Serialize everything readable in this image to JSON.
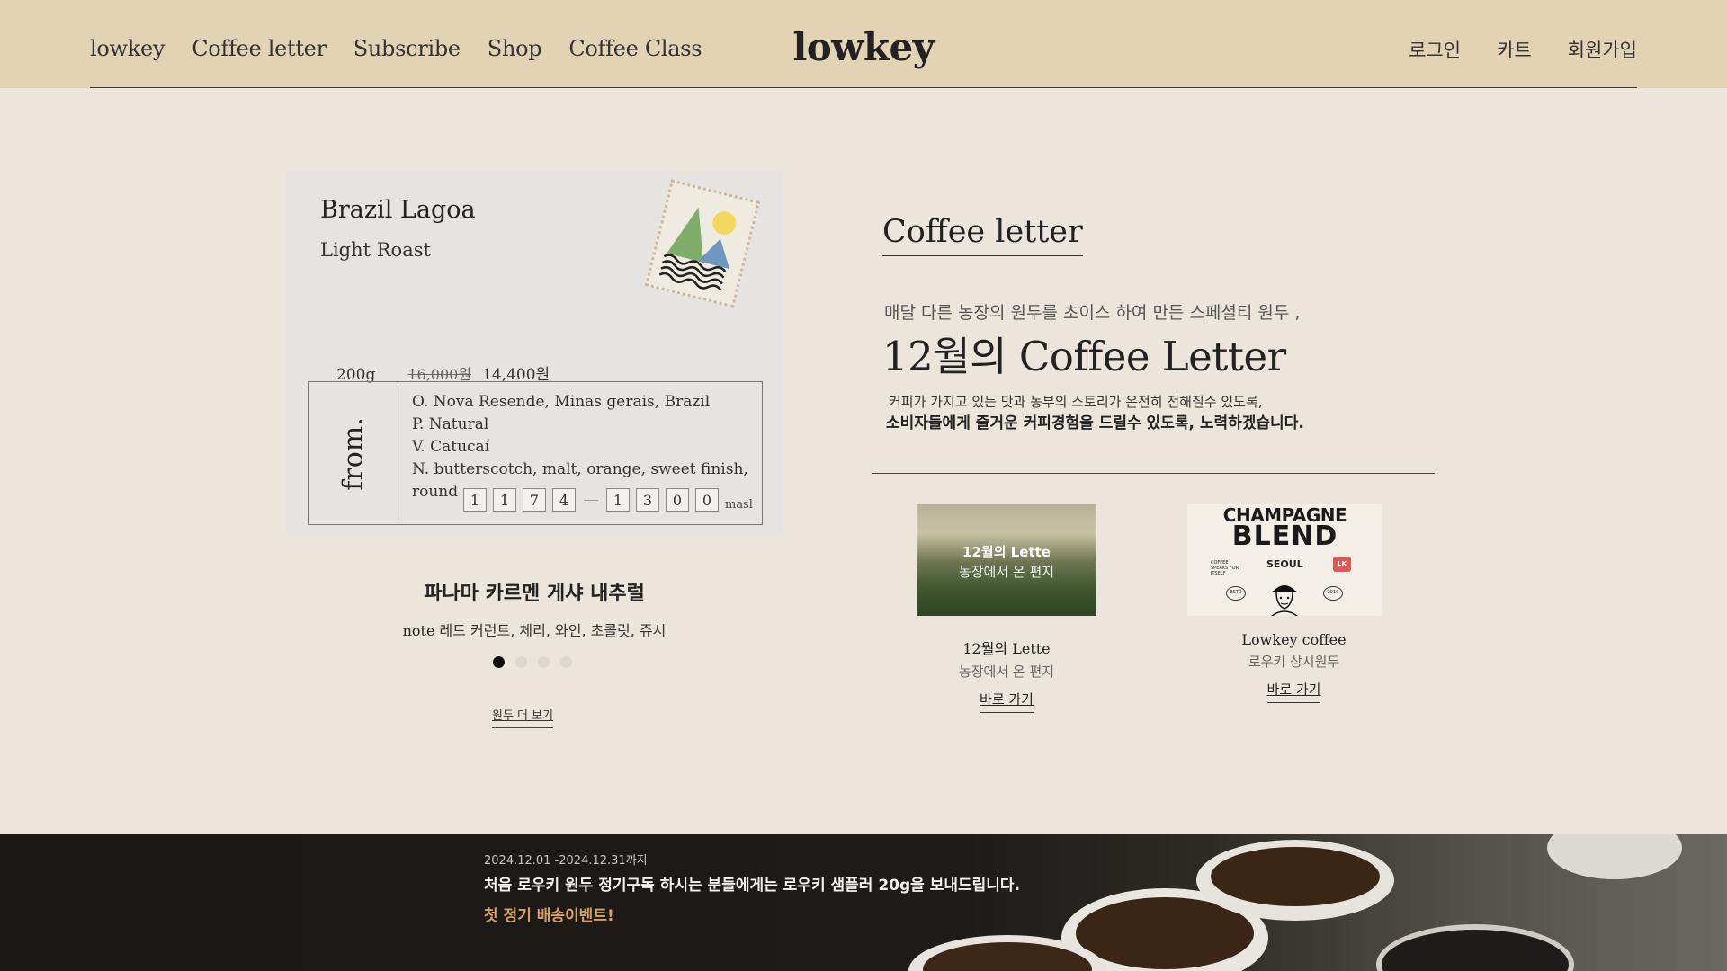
{
  "nav": {
    "left": [
      "lowkey",
      "Coffee letter",
      "Subscribe",
      "Shop",
      "Coffee Class"
    ],
    "logo": "lowkey",
    "right": [
      "로그인",
      "카트",
      "회원가입"
    ]
  },
  "product_card": {
    "name": "Brazil Lagoa",
    "roast": "Light Roast",
    "weight": "200g",
    "original_price": "16,000원",
    "price": "14,400원",
    "from_label": "from.",
    "origin": "O. Nova Resende, Minas gerais, Brazil",
    "process": "P. Natural",
    "variety": "V. Catucaí",
    "notes": "N. butterscotch, malt, orange, sweet finish, round",
    "altitude_digits_low": [
      "1",
      "1",
      "7",
      "4"
    ],
    "altitude_digits_high": [
      "1",
      "3",
      "0",
      "0"
    ],
    "altitude_unit": "masl"
  },
  "featured": {
    "title": "파나마 카르멘 게샤 내추럴",
    "note_label": "note",
    "note_text": "레드 커런트, 체리, 와인, 초콜릿, 쥬시",
    "slide_count": 4,
    "active_slide": 1,
    "more_link": "원두 더 보기"
  },
  "letter": {
    "heading": "Coffee letter",
    "intro": "매달 다른 농장의 원두를 초이스 하여 만든 스페셜티 원두 ,",
    "big_title": "12월의 Coffee Letter",
    "desc_line1": "커피가 가지고 있는 맛과 농부의 스토리가 온전히 전해질수 있도록,",
    "desc_line2": "소비자들에게 즐거운 커피경험을 드릴수 있도록, 노력하겠습니다.",
    "items": [
      {
        "image_title": "12월의 Lette",
        "image_subtitle": "농장에서 온 편지",
        "title": "12월의 Lette",
        "subtitle": "농장에서 온 편지",
        "link": "바로 가기"
      },
      {
        "image_line1": "CHAMPAGNE",
        "image_line2": "BLEND",
        "image_line3": "SEOUL",
        "image_tag": "COFFEE SPEAKS FOR ITSELF",
        "image_badge": "LK",
        "image_left_oval": "ESTD",
        "image_right_oval": "2010",
        "title": "Lowkey coffee",
        "subtitle": "로우키 상시원두",
        "link": "바로 가기"
      }
    ]
  },
  "banner": {
    "date": "2024.12.01 -2024.12.31까지",
    "main": "처음 로우키  원두 정기구독 하시는 분들에게는 로우키 샘플러 20g을 보내드립니다.",
    "event": "첫 정기 배송이벤트!"
  },
  "colors": {
    "header_bg": "#e3d3b5",
    "page_bg": "#ebe5db",
    "event_accent": "#d8a35c"
  }
}
